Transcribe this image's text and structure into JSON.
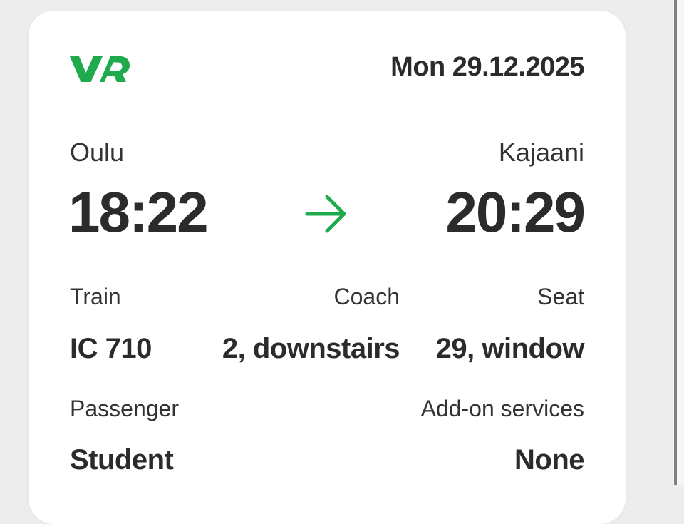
{
  "header": {
    "logo_text": "VR",
    "date": "Mon 29.12.2025"
  },
  "journey": {
    "from_city": "Oulu",
    "to_city": "Kajaani",
    "departure_time": "18:22",
    "arrival_time": "20:29"
  },
  "details": {
    "train_label": "Train",
    "train_value": "IC 710",
    "coach_label": "Coach",
    "coach_value": "2, downstairs",
    "seat_label": "Seat",
    "seat_value": "29, window",
    "passenger_label": "Passenger",
    "passenger_value": "Student",
    "addon_label": "Add-on services",
    "addon_value": "None"
  },
  "colors": {
    "brand_green": "#1faa4d",
    "text": "#2b2b2b",
    "background": "#ededed",
    "card": "#ffffff"
  },
  "icons": {
    "logo": "vr-logo",
    "arrow": "arrow-right-icon"
  }
}
